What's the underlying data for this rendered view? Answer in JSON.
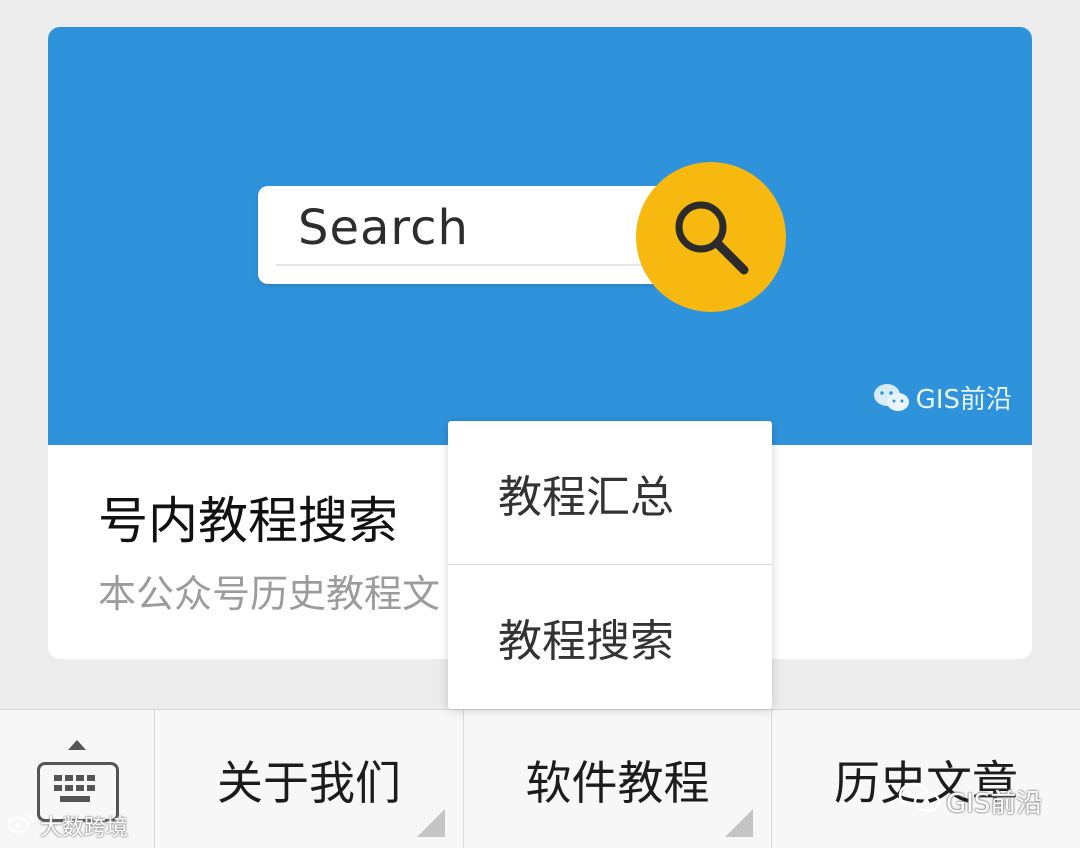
{
  "card": {
    "banner": {
      "search_text": "Search",
      "watermark": "GIS前沿",
      "bg_color": "#2f93dc",
      "accent_color": "#f7b90f"
    },
    "title": "号内教程搜索",
    "description": "本公众号历史教程文"
  },
  "popup": {
    "items": [
      {
        "label": "教程汇总"
      },
      {
        "label": "教程搜索"
      }
    ]
  },
  "menu": {
    "keyboard_icon": "keyboard-icon",
    "items": [
      {
        "label": "关于我们",
        "has_submenu": true
      },
      {
        "label": "软件教程",
        "has_submenu": true
      },
      {
        "label": "历史文章",
        "has_submenu": false
      }
    ]
  },
  "watermarks": {
    "bottom_left": "大数跨境",
    "bottom_right": "GIS前沿"
  }
}
